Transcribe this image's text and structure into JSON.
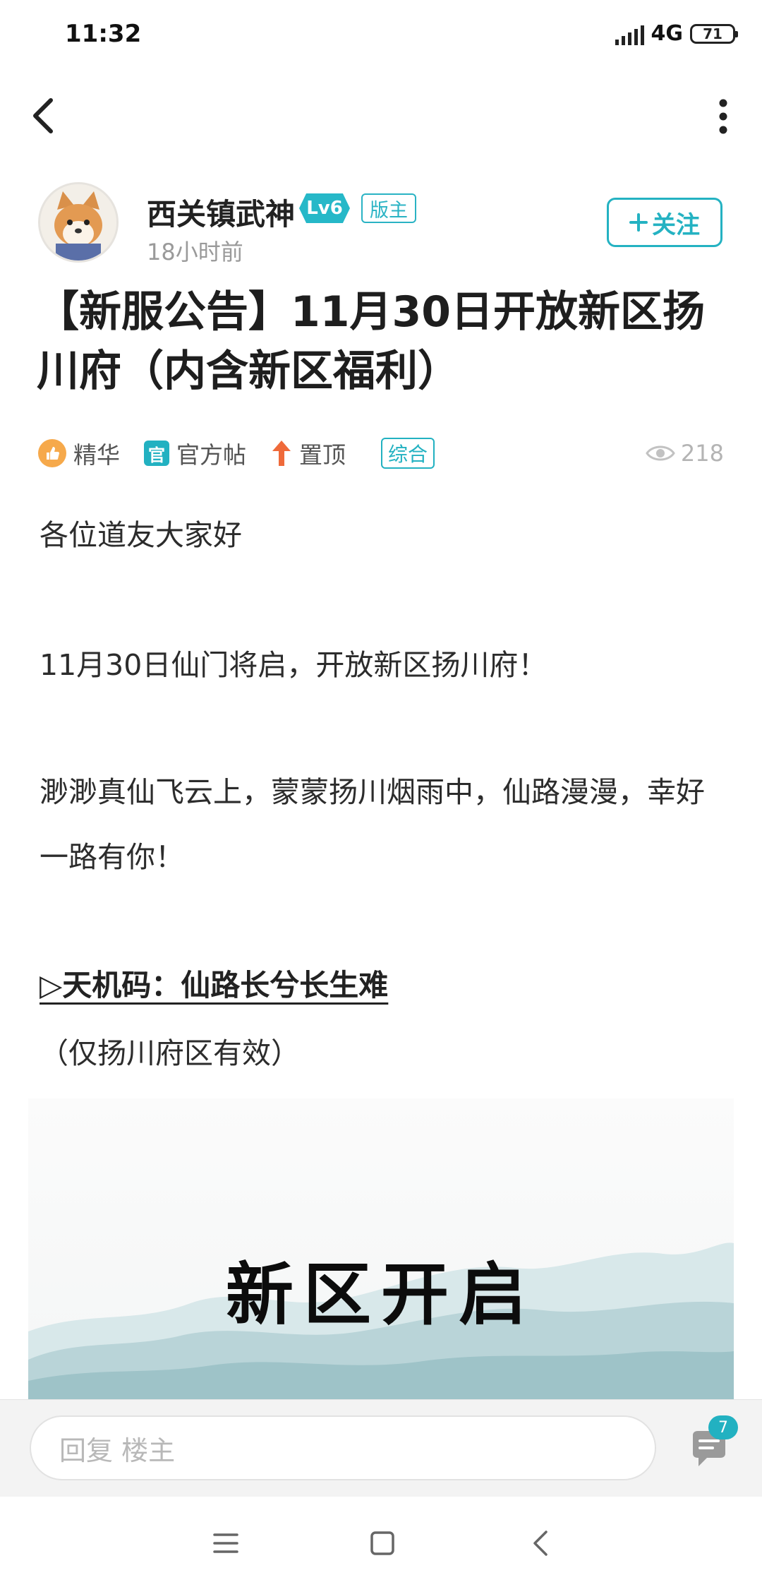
{
  "status_bar": {
    "time": "11:32",
    "network": "4G",
    "battery": "71"
  },
  "author": {
    "name": "西关镇武神",
    "level": "Lv6",
    "role": "版主",
    "time_ago": "18小时前",
    "follow_label": "关注"
  },
  "post": {
    "title": "【新服公告】11月30日开放新区扬川府（内含新区福利）",
    "tags": {
      "essence": "精华",
      "official_icon": "官",
      "official": "官方帖",
      "pinned": "置顶",
      "category": "综合"
    },
    "views": "218",
    "paragraphs": [
      "各位道友大家好",
      "11月30日仙门将启，开放新区扬川府！",
      "渺渺真仙飞云上，蒙蒙扬川烟雨中，仙路漫漫，幸好一路有你！"
    ],
    "code_line": "▷天机码：仙路长兮长生难",
    "code_note": "（仅扬川府区有效）",
    "banner_text": "新区开启"
  },
  "reply": {
    "placeholder": "回复  楼主",
    "comment_count": "7"
  },
  "colors": {
    "accent": "#22b1c1",
    "essence": "#f6a94b",
    "pinned": "#ef6a3a"
  }
}
